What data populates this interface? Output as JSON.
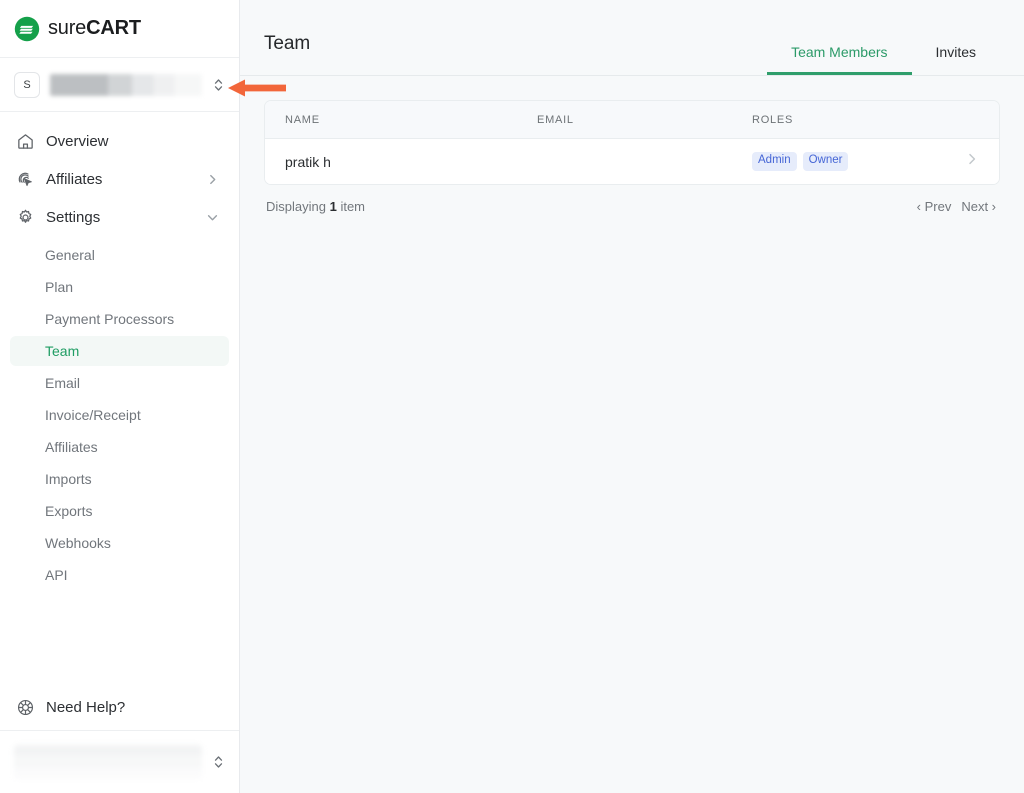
{
  "brand": {
    "name_thin": "sure",
    "name_bold": "CART",
    "logo_icon": "surecart-logo-icon",
    "color": "#15a04a"
  },
  "store_selector": {
    "avatar_initial": "S",
    "store_name_redacted": true,
    "selector_icon": "up-down-chevron-icon"
  },
  "sidebar": {
    "items": [
      {
        "label": "Overview",
        "icon": "home-icon",
        "has_chevron": false
      },
      {
        "label": "Affiliates",
        "icon": "affiliate-cursor-icon",
        "has_chevron": true,
        "chevron": "chevron-right-icon"
      },
      {
        "label": "Settings",
        "icon": "gear-icon",
        "has_chevron": true,
        "chevron": "chevron-down-icon"
      }
    ],
    "subitems": [
      {
        "label": "General",
        "active": false
      },
      {
        "label": "Plan",
        "active": false
      },
      {
        "label": "Payment Processors",
        "active": false
      },
      {
        "label": "Team",
        "active": true
      },
      {
        "label": "Email",
        "active": false
      },
      {
        "label": "Invoice/Receipt",
        "active": false
      },
      {
        "label": "Affiliates",
        "active": false
      },
      {
        "label": "Imports",
        "active": false
      },
      {
        "label": "Exports",
        "active": false
      },
      {
        "label": "Webhooks",
        "active": false
      },
      {
        "label": "API",
        "active": false
      }
    ],
    "help": {
      "label": "Need Help?",
      "icon": "lifebuoy-icon"
    },
    "user": {
      "redacted": true,
      "selector_icon": "up-down-chevron-icon"
    },
    "active_color": "#1f9d63"
  },
  "header": {
    "title": "Team",
    "tabs": [
      {
        "label": "Team Members",
        "active": true
      },
      {
        "label": "Invites",
        "active": false
      }
    ],
    "active_tab_color": "#2f9e6b"
  },
  "table": {
    "columns": [
      "NAME",
      "EMAIL",
      "ROLES"
    ],
    "rows": [
      {
        "name": "pratik h",
        "email_redacted": true,
        "roles": [
          "Admin",
          "Owner"
        ],
        "row_chevron": "chevron-right-icon"
      }
    ],
    "badge_bg": "#e6ecfb",
    "badge_color": "#4666d6"
  },
  "footer": {
    "displaying_prefix": "Displaying ",
    "displaying_count": "1",
    "displaying_suffix": " item",
    "prev_label": "‹ Prev",
    "next_label": "Next ›"
  },
  "annotation": {
    "arrow_icon": "left-arrow-annotation",
    "color": "#f2663a"
  }
}
